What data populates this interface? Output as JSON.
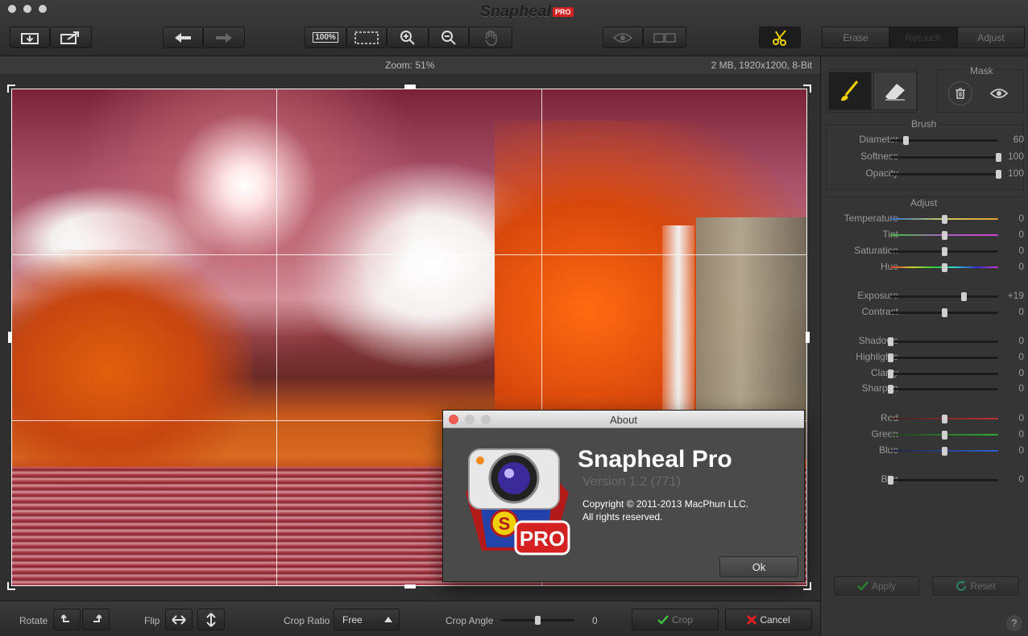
{
  "titlebar": {
    "app_name": "Snapheal",
    "badge": "PRO",
    "zoom_100_label": "100%",
    "tabs": [
      {
        "label": "Erase",
        "active": false
      },
      {
        "label": "Retouch",
        "active": true
      },
      {
        "label": "Adjust",
        "active": false
      }
    ]
  },
  "infobar": {
    "zoom": "Zoom: 51%",
    "meta": "2 MB, 1920x1200, 8-Bit"
  },
  "bottombar": {
    "rotate_label": "Rotate",
    "flip_label": "Flip",
    "crop_ratio_label": "Crop Ratio",
    "crop_ratio_value": "Free",
    "crop_angle_label": "Crop Angle",
    "crop_angle_value": "0",
    "crop_angle_fraction": 0.5,
    "crop_button": "Crop",
    "cancel_button": "Cancel"
  },
  "about": {
    "window_title": "About",
    "app_name": "Snapheal Pro",
    "version": "Version 1.2 (771)",
    "copyright": "Copyright © 2011-2013 MacPhun LLC.",
    "rights": "All rights reserved.",
    "ok_button": "Ok",
    "icon_badge": "PRO",
    "icon_letter": "S"
  },
  "panel": {
    "mask_label": "Mask",
    "brush_label": "Brush",
    "adjust_label": "Adjust",
    "brush": [
      {
        "label": "Diameter",
        "value": "60",
        "pos": 0.14
      },
      {
        "label": "Softness",
        "value": "100",
        "pos": 1.0
      },
      {
        "label": "Opacity",
        "value": "100",
        "pos": 1.0
      }
    ],
    "adjust": [
      {
        "label": "Temperature",
        "value": "0",
        "pos": 0.5,
        "track": "temp"
      },
      {
        "label": "Tint",
        "value": "0",
        "pos": 0.5,
        "track": "tint"
      },
      {
        "label": "Saturation",
        "value": "0",
        "pos": 0.5,
        "track": "plain"
      },
      {
        "label": "Hue",
        "value": "0",
        "pos": 0.5,
        "track": "hue"
      },
      {
        "label": "Exposure",
        "value": "+19",
        "pos": 0.68,
        "track": "plain"
      },
      {
        "label": "Contrast",
        "value": "0",
        "pos": 0.5,
        "track": "plain"
      },
      {
        "label": "Shadows",
        "value": "0",
        "pos": 0.0,
        "track": "plain"
      },
      {
        "label": "Highlights",
        "value": "0",
        "pos": 0.0,
        "track": "plain"
      },
      {
        "label": "Clarity",
        "value": "0",
        "pos": 0.0,
        "track": "plain"
      },
      {
        "label": "Sharpen",
        "value": "0",
        "pos": 0.0,
        "track": "plain"
      },
      {
        "label": "Red",
        "value": "0",
        "pos": 0.5,
        "track": "red"
      },
      {
        "label": "Green",
        "value": "0",
        "pos": 0.5,
        "track": "green"
      },
      {
        "label": "Blue",
        "value": "0",
        "pos": 0.5,
        "track": "blue"
      },
      {
        "label": "Blur",
        "value": "0",
        "pos": 0.0,
        "track": "plain"
      }
    ],
    "apply_button": "Apply",
    "reset_button": "Reset",
    "help": "?"
  },
  "colors": {
    "accent_yellow": "#f0d000",
    "pro_red": "#d42121",
    "close_red": "#ee5b53",
    "apply_green": "#3fbf3f",
    "cancel_red": "#e02020"
  }
}
